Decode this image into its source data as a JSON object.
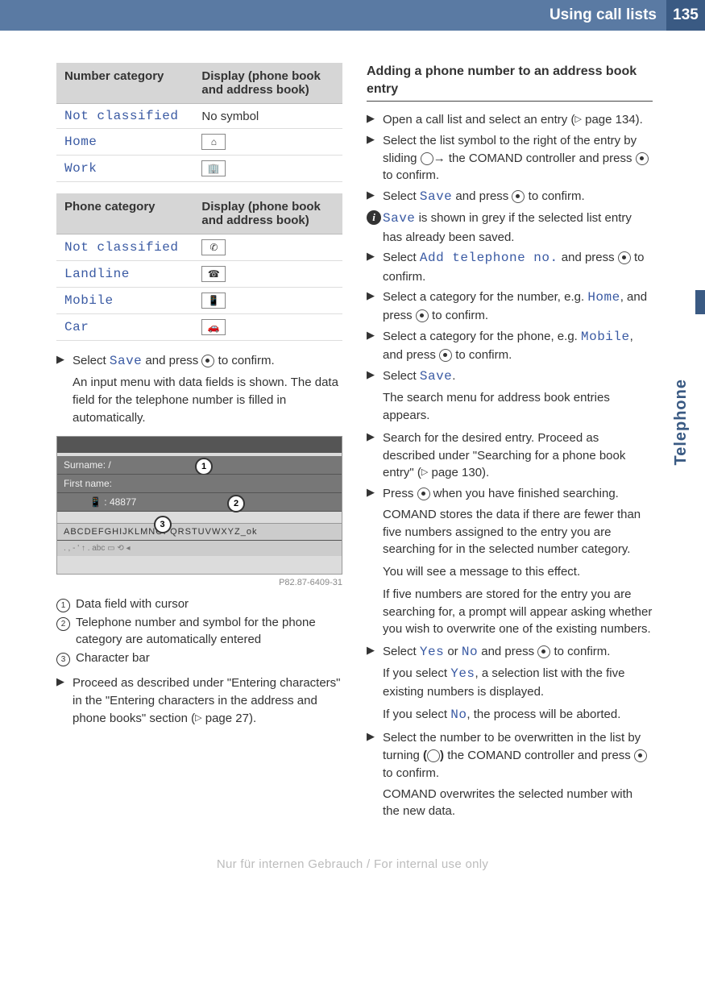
{
  "header": {
    "title": "Using call lists",
    "page_number": "135"
  },
  "side_label": "Telephone",
  "caption_code": "P82.87-6409-31",
  "footer": "Nur für internen Gebrauch / For internal use only",
  "table1": {
    "h1": "Number category",
    "h2": "Display (phone book and address book)",
    "rows": [
      {
        "label": "Not classified",
        "display": "No symbol",
        "icon": ""
      },
      {
        "label": "Home",
        "display": "",
        "icon": "⌂"
      },
      {
        "label": "Work",
        "display": "",
        "icon": "🏢"
      }
    ]
  },
  "table2": {
    "h1": "Phone category",
    "h2": "Display (phone book and address book)",
    "rows": [
      {
        "label": "Not classified",
        "icon": "✆"
      },
      {
        "label": "Landline",
        "icon": "☎"
      },
      {
        "label": "Mobile",
        "icon": "📱"
      },
      {
        "label": "Car",
        "icon": "🚗"
      }
    ]
  },
  "left_steps": {
    "s1": "Select ",
    "s1_ui": "Save",
    "s1b": " and press ",
    "s1c": " to confirm.",
    "s1_cont": "An input menu with data fields is shown. The data field for the telephone number is filled in automatically."
  },
  "fig": {
    "row1": "Surname:",
    "row2": "First name:",
    "row2_value": "48877",
    "row3_chars": "ABCDEFGHIJKLMNOPQRSTUVWXYZ_ok",
    "badge1": "1",
    "badge2": "2",
    "badge3": "3"
  },
  "legend": {
    "i1": "Data field with cursor",
    "i2": "Telephone number and symbol for the phone category are automatically entered",
    "i3": "Character bar"
  },
  "left_step2": {
    "a": "Proceed as described under \"Entering characters\" in the \"Entering characters in the address and phone books\" section (",
    "b": " page 27)."
  },
  "right": {
    "heading": "Adding a phone number to an address book entry",
    "s1a": "Open a call list and select an entry (",
    "s1b": " page 134).",
    "s2a": "Select the list symbol to the right of the entry by sliding ",
    "s2b": " the COMAND controller and press ",
    "s2c": " to confirm.",
    "s3a": "Select ",
    "s3_ui": "Save",
    "s3b": " and press ",
    "s3c": " to confirm.",
    "info_ui": "Save",
    "info_txt": " is shown in grey if the selected list entry has already been saved.",
    "s4a": "Select ",
    "s4_ui": "Add telephone no.",
    "s4b": " and press ",
    "s4c": " to confirm.",
    "s5a": "Select a category for the number, e.g. ",
    "s5_ui": "Home",
    "s5b": ", and press ",
    "s5c": " to confirm.",
    "s6a": "Select a category for the phone, e.g. ",
    "s6_ui": "Mobile",
    "s6b": ", and press ",
    "s6c": " to confirm.",
    "s7a": "Select ",
    "s7_ui": "Save",
    "s7b": ".",
    "s7_cont": "The search menu for address book entries appears.",
    "s8a": "Search for the desired entry. Proceed as described under \"Searching for a phone book entry\" (",
    "s8b": " page 130).",
    "s9a": "Press ",
    "s9b": " when you have finished searching.",
    "s9_cont1": "COMAND stores the data if there are fewer than five numbers assigned to the entry you are searching for in the selected number category.",
    "s9_cont2": "You will see a message to this effect.",
    "s9_cont3": "If five numbers are stored for the entry you are searching for, a prompt will appear asking whether you wish to overwrite one of the existing numbers.",
    "s10a": "Select ",
    "s10_ui1": "Yes",
    "s10b": " or ",
    "s10_ui2": "No",
    "s10c": " and press ",
    "s10d": " to confirm.",
    "s10_cont1a": "If you select ",
    "s10_cont1_ui": "Yes",
    "s10_cont1b": ", a selection list with the five existing numbers is displayed.",
    "s10_cont2a": "If you select ",
    "s10_cont2_ui": "No",
    "s10_cont2b": ", the process will be aborted.",
    "s11a": "Select the number to be overwritten in the list by turning ",
    "s11b": " the COMAND controller and press ",
    "s11c": " to confirm.",
    "s11_cont": "COMAND overwrites the selected number with the new data."
  }
}
